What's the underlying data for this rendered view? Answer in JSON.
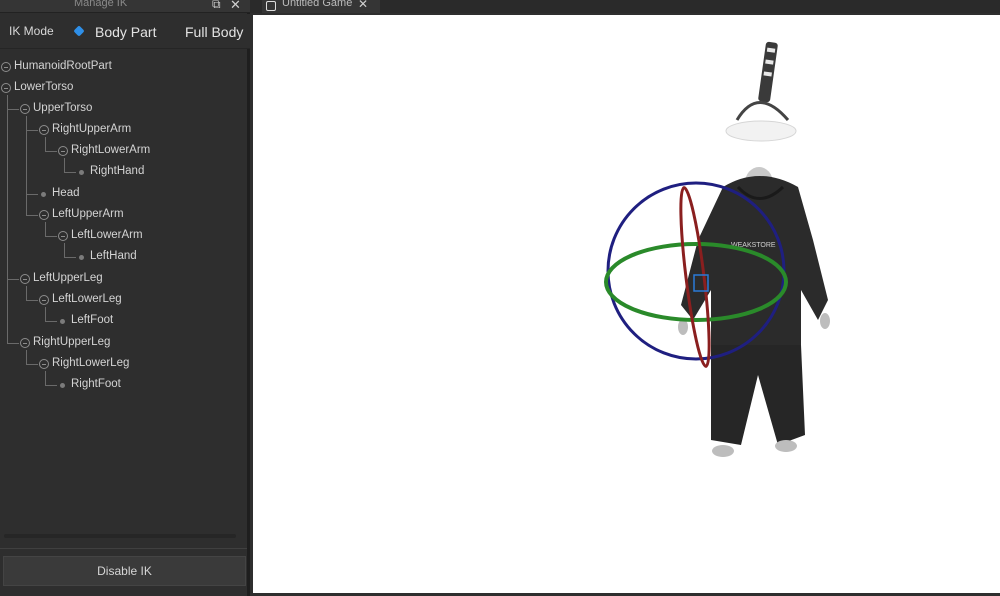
{
  "panel": {
    "title": "Manage IK",
    "mode_label": "IK Mode",
    "options": {
      "body_part": "Body Part",
      "full_body": "Full Body"
    },
    "selected_mode": "body_part",
    "accent_color": "#2e8fe8",
    "disable_button": "Disable IK"
  },
  "tree": {
    "nodes": [
      {
        "label": "HumanoidRootPart",
        "type": "group"
      },
      {
        "label": "LowerTorso",
        "type": "group"
      },
      {
        "label": "UpperTorso",
        "type": "group"
      },
      {
        "label": "RightUpperArm",
        "type": "group"
      },
      {
        "label": "RightLowerArm",
        "type": "group"
      },
      {
        "label": "RightHand",
        "type": "leaf"
      },
      {
        "label": "Head",
        "type": "leaf"
      },
      {
        "label": "LeftUpperArm",
        "type": "group"
      },
      {
        "label": "LeftLowerArm",
        "type": "group"
      },
      {
        "label": "LeftHand",
        "type": "leaf"
      },
      {
        "label": "LeftUpperLeg",
        "type": "group"
      },
      {
        "label": "LeftLowerLeg",
        "type": "group"
      },
      {
        "label": "LeftFoot",
        "type": "leaf"
      },
      {
        "label": "RightUpperLeg",
        "type": "group"
      },
      {
        "label": "RightLowerLeg",
        "type": "group"
      },
      {
        "label": "RightFoot",
        "type": "leaf"
      }
    ]
  },
  "tabs": {
    "game_tab": "Untitled Game"
  },
  "viewport": {
    "character_shirt_text": "WEAKSTORE",
    "gizmo_colors": {
      "ring_y": "#1f1f80",
      "ring_x": "#2a8a2a",
      "ring_z": "#8a1f1f"
    }
  }
}
